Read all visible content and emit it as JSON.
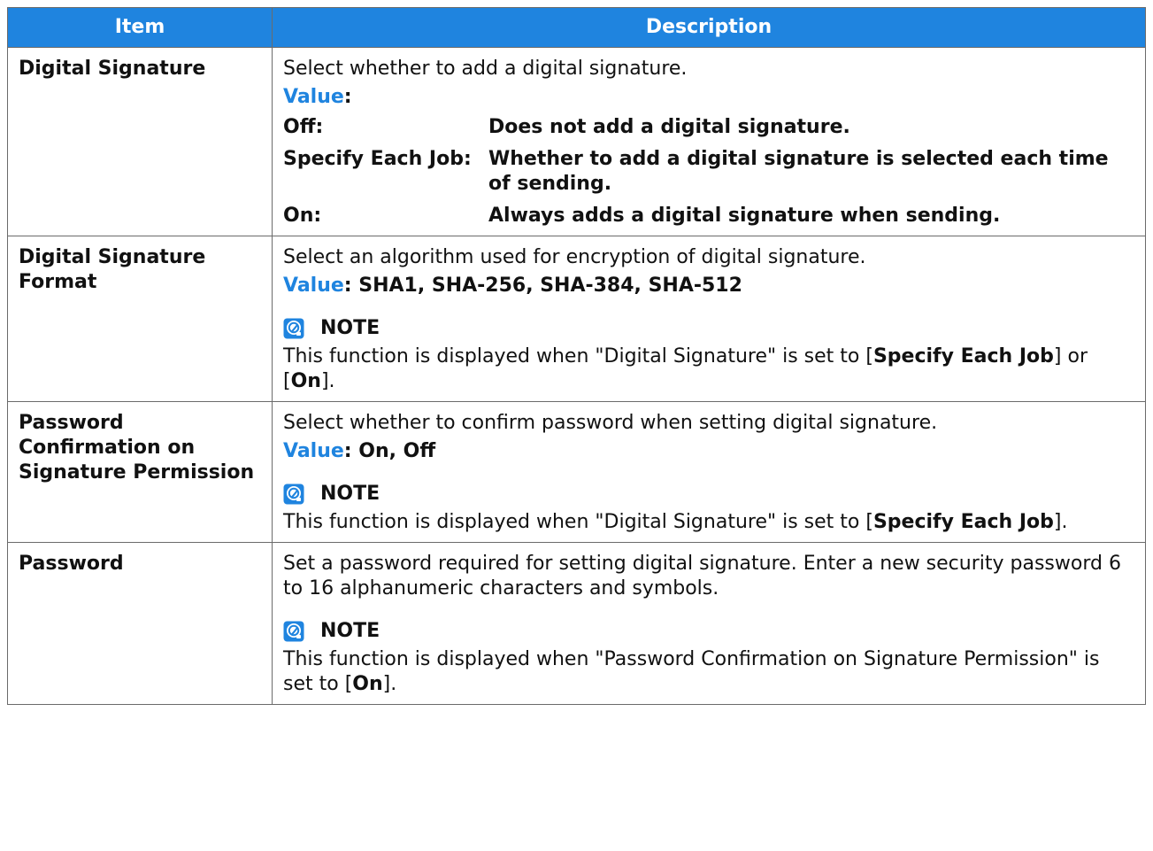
{
  "header": {
    "item": "Item",
    "description": "Description"
  },
  "rows": [
    {
      "item": "Digital Signature",
      "description": "Select whether to add a digital signature.",
      "value_label": "Value",
      "value_colon": ":",
      "options": [
        {
          "key": "Off:",
          "text": "Does not add a digital signature."
        },
        {
          "key": "Specify Each Job:",
          "text": "Whether to add a digital signature is selected each time of sending."
        },
        {
          "key": "On:",
          "text": "Always adds a digital signature when sending."
        }
      ]
    },
    {
      "item": "Digital Signature Format",
      "description": "Select an algorithm used for encryption of digital signature.",
      "value_label": "Value",
      "value_text": ": SHA1, SHA-256, SHA-384, SHA-512",
      "note_label": "NOTE",
      "note_text_1": "This function is displayed when \"Digital Signature\" is set to [",
      "note_bold_1": "Specify Each Job",
      "note_text_2": "] or [",
      "note_bold_2": "On",
      "note_text_3": "]."
    },
    {
      "item": "Password Confirmation on Signature Permission",
      "description": "Select whether to confirm password when setting digital signature.",
      "value_label": "Value",
      "value_text": ": On, Off",
      "note_label": "NOTE",
      "note_text_1": "This function is displayed when \"Digital Signature\" is set to [",
      "note_bold_1": "Specify Each Job",
      "note_text_2": "]."
    },
    {
      "item": "Password",
      "description": "Set a password required for setting digital signature. Enter a new security password 6 to 16 alphanumeric characters and symbols.",
      "note_label": "NOTE",
      "note_text_1": "This function is displayed when \"Password Confirmation on Signature Permission\" is set to [",
      "note_bold_1": "On",
      "note_text_2": "]."
    }
  ],
  "colors": {
    "header_bg": "#1f84df",
    "value_label": "#1f84df",
    "border": "#6b6b6b"
  },
  "icons": {
    "note": "note-lightbulb-icon"
  }
}
